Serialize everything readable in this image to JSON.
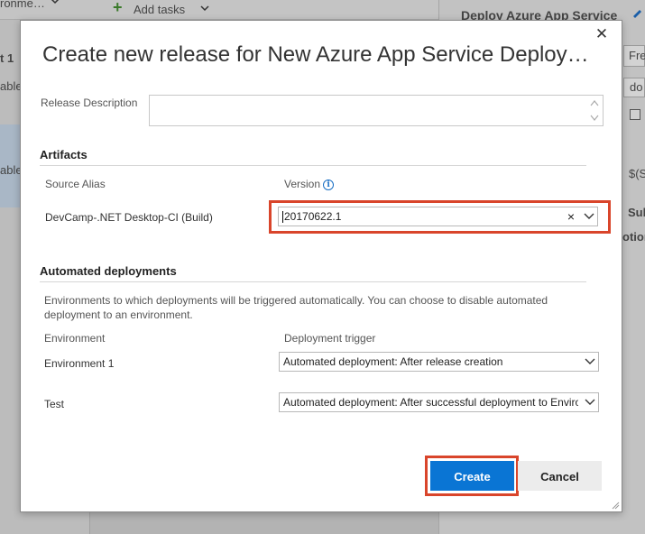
{
  "background": {
    "toolbar_left_text": "ronme…",
    "add_tasks_label": "Add tasks",
    "right_panel_title": "Deploy Azure App Service",
    "left_snippets": [
      "t 1",
      "able",
      "able"
    ],
    "right_snippets": [
      "Fre",
      "do",
      "$(S",
      "Sub",
      "otion"
    ]
  },
  "dialog": {
    "title": "Create new release for New Azure App Service Deployme…",
    "release_description_label": "Release Description",
    "release_description_value": "",
    "artifacts": {
      "heading": "Artifacts",
      "source_alias_header": "Source Alias",
      "version_header": "Version",
      "rows": [
        {
          "source_alias": "DevCamp-.NET Desktop-CI (Build)",
          "version": "20170622.1"
        }
      ]
    },
    "automated_deployments": {
      "heading": "Automated deployments",
      "description": "Environments to which deployments will be triggered automatically. You can choose to disable automated deployment to an environment.",
      "environment_header": "Environment",
      "trigger_header": "Deployment trigger",
      "rows": [
        {
          "environment": "Environment 1",
          "trigger": "Automated deployment: After release creation"
        },
        {
          "environment": "Test",
          "trigger": "Automated deployment: After successful deployment to Enviro"
        }
      ]
    },
    "buttons": {
      "create": "Create",
      "cancel": "Cancel"
    }
  },
  "colors": {
    "accent": "#0a75d4",
    "highlight": "#d9452b"
  },
  "icons": {
    "close": "close-icon",
    "info": "info-icon",
    "dropdown": "chevron-down-icon",
    "clear": "clear-icon",
    "add": "plus-icon",
    "edit": "pencil-icon"
  }
}
